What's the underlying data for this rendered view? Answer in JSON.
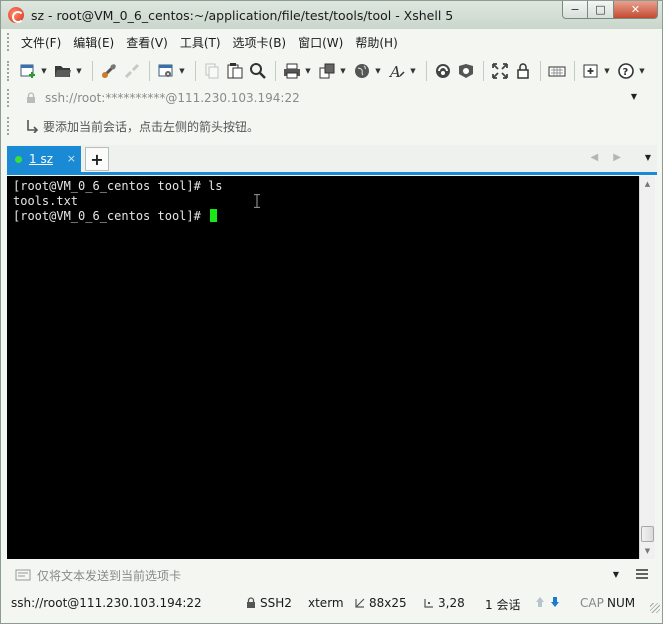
{
  "window": {
    "title": "sz - root@VM_0_6_centos:~/application/file/test/tools/tool - Xshell 5",
    "controls": {
      "minimize": "−",
      "maximize": "□",
      "close": "✕"
    }
  },
  "menu": {
    "items": [
      {
        "id": "file",
        "label": "文件(F)"
      },
      {
        "id": "edit",
        "label": "编辑(E)"
      },
      {
        "id": "view",
        "label": "查看(V)"
      },
      {
        "id": "tools",
        "label": "工具(T)"
      },
      {
        "id": "tab",
        "label": "选项卡(B)"
      },
      {
        "id": "window",
        "label": "窗口(W)"
      },
      {
        "id": "help",
        "label": "帮助(H)"
      }
    ]
  },
  "toolbar": {
    "icons": [
      "new-session-icon",
      "open-folder-icon",
      "connect-icon",
      "disconnect-icon",
      "properties-icon",
      "copy-icon",
      "paste-icon",
      "find-icon",
      "print-icon",
      "transfer-icon",
      "globe-icon",
      "font-icon",
      "xftp-icon",
      "xmanager-icon",
      "fullscreen-icon",
      "lock-icon",
      "keyboard-icon",
      "add-icon",
      "help-icon"
    ]
  },
  "address": {
    "text": "ssh://root:**********@111.230.103.194:22",
    "dropdown": "▼"
  },
  "hint": {
    "text": "要添加当前会话，点击左侧的箭头按钮。"
  },
  "tabs": {
    "items": [
      {
        "label": "1 sz",
        "status_color": "#3cde3c",
        "close": "×"
      }
    ],
    "add": "+",
    "nav": "◀ ▶",
    "dropdown": "▼"
  },
  "terminal": {
    "lines": [
      "[root@VM_0_6_centos tool]# ls",
      "tools.txt",
      "[root@VM_0_6_centos tool]# "
    ],
    "cursor_color": "#18e818",
    "scroll_up": "▲",
    "scroll_down": "▼"
  },
  "compose": {
    "placeholder": "仅将文本发送到当前选项卡",
    "dropdown": "▼"
  },
  "status": {
    "connection": "ssh://root@111.230.103.194:22",
    "protocol": "SSH2",
    "terminal_type": "xterm",
    "size": "88x25",
    "position": "3,28",
    "sessions": "1 会话",
    "caps": "CAP",
    "num": "NUM"
  },
  "colors": {
    "accent": "#1a8ad4",
    "terminal_bg": "#000000",
    "terminal_fg": "#e6e6e6"
  }
}
